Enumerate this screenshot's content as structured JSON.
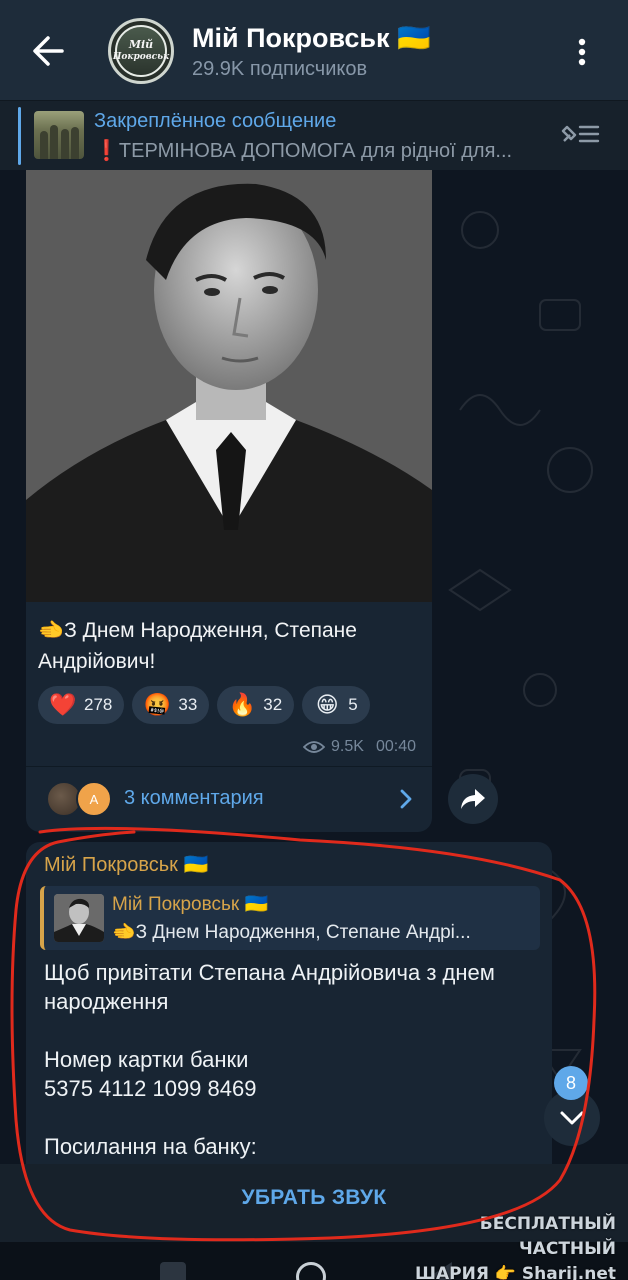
{
  "header": {
    "channel_name": "Мій Покровськ 🇺🇦",
    "subscribers": "29.9K подписчиков",
    "avatar_text_line1": "Мій",
    "avatar_text_line2": "Покровськ"
  },
  "pinned": {
    "title": "Закреплённое сообщение",
    "text": "ТЕРМІНОВА ДОПОМОГА для рідної для..."
  },
  "post": {
    "text": "🫲З Днем Народження, Степане Андрійович!",
    "reactions": [
      {
        "emoji": "❤️",
        "count": "278",
        "icon": "red-heart-icon"
      },
      {
        "emoji": "🤬",
        "count": "33",
        "icon": "cursing-face-icon"
      },
      {
        "emoji": "🔥",
        "count": "32",
        "icon": "fire-icon"
      },
      {
        "emoji": "😁",
        "count": "5",
        "icon": "grinning-face-icon"
      }
    ],
    "views": "9.5K",
    "time": "00:40",
    "comments_avatar_letter": "A",
    "comments_label": "3 комментария"
  },
  "reply_message": {
    "author": "Мій Покровськ 🇺🇦",
    "quote_author": "Мій Покровськ 🇺🇦",
    "quote_text": "🫲З Днем Народження, Степане Андрі...",
    "body": "Щоб привітати Степана Андрійовича з днем народження\n\nНомер картки банки\n5375 4112 1099 8469\n\nПосилання на банку:"
  },
  "scroll": {
    "unread_count": "8"
  },
  "bottom": {
    "mute_label": "УБРАТЬ ЗВУК"
  },
  "watermark": {
    "line1": "БЕСПЛАТНЫЙ ЧАСТНЫЙ",
    "line2": "ШАРИЯ 👉 Sharij.net"
  },
  "colors": {
    "accent": "#5fa8e9",
    "author": "#d7a44a",
    "annotation": "#e02a1c",
    "background": "#0e1621"
  }
}
